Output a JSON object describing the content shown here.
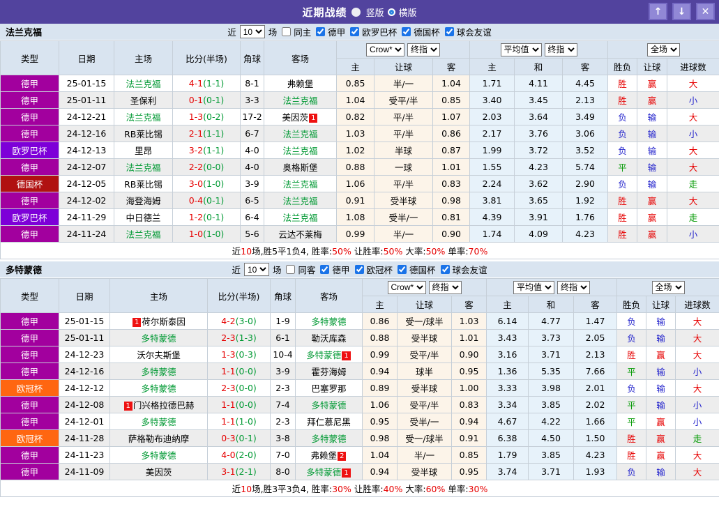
{
  "titlebar": {
    "title": "近期战绩",
    "radios": [
      {
        "label": "竖版",
        "selected": false
      },
      {
        "label": "横版",
        "selected": true
      }
    ],
    "buttons": {
      "up": "↑",
      "down": "↓",
      "close": "✕"
    }
  },
  "league_colors": {
    "德甲": "#a2009e",
    "欧罗巴杯": "#7d00d8",
    "德国杯": "#b01111",
    "欧冠杯": "#ff6611"
  },
  "result_colors": {
    "r": "#e60000",
    "b": "#2323cc",
    "g": "#009900"
  },
  "filter_labels": {
    "near": "近",
    "unit": "场"
  },
  "columns": {
    "type": "类型",
    "date": "日期",
    "home": "主场",
    "score": "比分(半场)",
    "corner": "角球",
    "away": "客场",
    "h": "主",
    "handicap": "让球",
    "a": "客",
    "avg_h": "主",
    "avg_d": "和",
    "avg_a": "客",
    "wl": "胜负",
    "hcp_res": "让球",
    "goals": "进球数"
  },
  "header_selects": {
    "odds_company": "Crow*",
    "odds_stage": "终指",
    "avg": "平均值",
    "avg_stage": "终指",
    "scope": "全场"
  },
  "sections": [
    {
      "team": "法兰克福",
      "filter": {
        "count": "10",
        "same": "同主",
        "same_checked": false,
        "leagues": [
          "德甲",
          "欧罗巴杯",
          "德国杯",
          "球会友谊"
        ]
      },
      "rows": [
        {
          "league": "德甲",
          "date": "25-01-15",
          "home": {
            "name": "法兰克福",
            "focus": true
          },
          "score": "4-1",
          "half": "(1-1)",
          "corner": "8-1",
          "away": {
            "name": "弗赖堡",
            "focus": false
          },
          "crow": [
            "0.85",
            "半/一",
            "1.04"
          ],
          "avg": [
            "1.71",
            "4.11",
            "4.45"
          ],
          "results": [
            [
              "胜",
              "r"
            ],
            [
              "赢",
              "r"
            ],
            [
              "大",
              "r"
            ]
          ]
        },
        {
          "league": "德甲",
          "date": "25-01-11",
          "home": {
            "name": "圣保利",
            "focus": false
          },
          "score": "0-1",
          "half": "(0-1)",
          "corner": "3-3",
          "away": {
            "name": "法兰克福",
            "focus": true
          },
          "crow": [
            "1.04",
            "受平/半",
            "0.85"
          ],
          "avg": [
            "3.40",
            "3.45",
            "2.13"
          ],
          "results": [
            [
              "胜",
              "r"
            ],
            [
              "赢",
              "r"
            ],
            [
              "小",
              "b"
            ]
          ]
        },
        {
          "league": "德甲",
          "date": "24-12-21",
          "home": {
            "name": "法兰克福",
            "focus": true
          },
          "score": "1-3",
          "half": "(0-2)",
          "corner": "17-2",
          "away": {
            "name": "美因茨",
            "focus": false,
            "badge": "1",
            "badge_pos": "after"
          },
          "crow": [
            "0.82",
            "平/半",
            "1.07"
          ],
          "avg": [
            "2.03",
            "3.64",
            "3.49"
          ],
          "results": [
            [
              "负",
              "b"
            ],
            [
              "输",
              "b"
            ],
            [
              "大",
              "r"
            ]
          ]
        },
        {
          "league": "德甲",
          "date": "24-12-16",
          "home": {
            "name": "RB莱比锡",
            "focus": false
          },
          "score": "2-1",
          "half": "(1-1)",
          "corner": "6-7",
          "away": {
            "name": "法兰克福",
            "focus": true
          },
          "crow": [
            "1.03",
            "平/半",
            "0.86"
          ],
          "avg": [
            "2.17",
            "3.76",
            "3.06"
          ],
          "results": [
            [
              "负",
              "b"
            ],
            [
              "输",
              "b"
            ],
            [
              "小",
              "b"
            ]
          ]
        },
        {
          "league": "欧罗巴杯",
          "date": "24-12-13",
          "home": {
            "name": "里昂",
            "focus": false
          },
          "score": "3-2",
          "half": "(1-1)",
          "corner": "4-0",
          "away": {
            "name": "法兰克福",
            "focus": true
          },
          "crow": [
            "1.02",
            "半球",
            "0.87"
          ],
          "avg": [
            "1.99",
            "3.72",
            "3.52"
          ],
          "results": [
            [
              "负",
              "b"
            ],
            [
              "输",
              "b"
            ],
            [
              "大",
              "r"
            ]
          ]
        },
        {
          "league": "德甲",
          "date": "24-12-07",
          "home": {
            "name": "法兰克福",
            "focus": true
          },
          "score": "2-2",
          "half": "(0-0)",
          "corner": "4-0",
          "away": {
            "name": "奥格斯堡",
            "focus": false
          },
          "crow": [
            "0.88",
            "一球",
            "1.01"
          ],
          "avg": [
            "1.55",
            "4.23",
            "5.74"
          ],
          "results": [
            [
              "平",
              "g"
            ],
            [
              "输",
              "b"
            ],
            [
              "大",
              "r"
            ]
          ]
        },
        {
          "league": "德国杯",
          "date": "24-12-05",
          "home": {
            "name": "RB莱比锡",
            "focus": false
          },
          "score": "3-0",
          "half": "(1-0)",
          "corner": "3-9",
          "away": {
            "name": "法兰克福",
            "focus": true
          },
          "crow": [
            "1.06",
            "平/半",
            "0.83"
          ],
          "avg": [
            "2.24",
            "3.62",
            "2.90"
          ],
          "results": [
            [
              "负",
              "b"
            ],
            [
              "输",
              "b"
            ],
            [
              "走",
              "g"
            ]
          ]
        },
        {
          "league": "德甲",
          "date": "24-12-02",
          "home": {
            "name": "海登海姆",
            "focus": false
          },
          "score": "0-4",
          "half": "(0-1)",
          "corner": "6-5",
          "away": {
            "name": "法兰克福",
            "focus": true
          },
          "crow": [
            "0.91",
            "受半球",
            "0.98"
          ],
          "avg": [
            "3.81",
            "3.65",
            "1.92"
          ],
          "results": [
            [
              "胜",
              "r"
            ],
            [
              "赢",
              "r"
            ],
            [
              "大",
              "r"
            ]
          ]
        },
        {
          "league": "欧罗巴杯",
          "date": "24-11-29",
          "home": {
            "name": "中日德兰",
            "focus": false
          },
          "score": "1-2",
          "half": "(0-1)",
          "corner": "6-4",
          "away": {
            "name": "法兰克福",
            "focus": true
          },
          "crow": [
            "1.08",
            "受半/一",
            "0.81"
          ],
          "avg": [
            "4.39",
            "3.91",
            "1.76"
          ],
          "results": [
            [
              "胜",
              "r"
            ],
            [
              "赢",
              "r"
            ],
            [
              "走",
              "g"
            ]
          ]
        },
        {
          "league": "德甲",
          "date": "24-11-24",
          "home": {
            "name": "法兰克福",
            "focus": true
          },
          "score": "1-0",
          "half": "(1-0)",
          "corner": "5-6",
          "away": {
            "name": "云达不莱梅",
            "focus": false
          },
          "crow": [
            "0.99",
            "半/一",
            "0.90"
          ],
          "avg": [
            "1.74",
            "4.09",
            "4.23"
          ],
          "results": [
            [
              "胜",
              "r"
            ],
            [
              "赢",
              "r"
            ],
            [
              "小",
              "b"
            ]
          ]
        }
      ],
      "summary": [
        [
          "近",
          "k"
        ],
        [
          "10",
          "r"
        ],
        [
          "场,胜5平1负4, 胜率:",
          "k"
        ],
        [
          "50%",
          "r"
        ],
        [
          " 让胜率:",
          "k"
        ],
        [
          "50%",
          "r"
        ],
        [
          " 大率:",
          "k"
        ],
        [
          "50%",
          "r"
        ],
        [
          " 单率:",
          "k"
        ],
        [
          "70%",
          "r"
        ]
      ]
    },
    {
      "team": "多特蒙德",
      "filter": {
        "count": "10",
        "same": "同客",
        "same_checked": false,
        "leagues": [
          "德甲",
          "欧冠杯",
          "德国杯",
          "球会友谊"
        ]
      },
      "rows": [
        {
          "league": "德甲",
          "date": "25-01-15",
          "home": {
            "name": "荷尔斯泰因",
            "focus": false,
            "badge": "1",
            "badge_pos": "before"
          },
          "score": "4-2",
          "half": "(3-0)",
          "corner": "1-9",
          "away": {
            "name": "多特蒙德",
            "focus": true
          },
          "crow": [
            "0.86",
            "受一/球半",
            "1.03"
          ],
          "avg": [
            "6.14",
            "4.77",
            "1.47"
          ],
          "results": [
            [
              "负",
              "b"
            ],
            [
              "输",
              "b"
            ],
            [
              "大",
              "r"
            ]
          ]
        },
        {
          "league": "德甲",
          "date": "25-01-11",
          "home": {
            "name": "多特蒙德",
            "focus": true
          },
          "score": "2-3",
          "half": "(1-3)",
          "corner": "6-1",
          "away": {
            "name": "勒沃库森",
            "focus": false
          },
          "crow": [
            "0.88",
            "受半球",
            "1.01"
          ],
          "avg": [
            "3.43",
            "3.73",
            "2.05"
          ],
          "results": [
            [
              "负",
              "b"
            ],
            [
              "输",
              "b"
            ],
            [
              "大",
              "r"
            ]
          ]
        },
        {
          "league": "德甲",
          "date": "24-12-23",
          "home": {
            "name": "沃尔夫斯堡",
            "focus": false
          },
          "score": "1-3",
          "half": "(0-3)",
          "corner": "10-4",
          "away": {
            "name": "多特蒙德",
            "focus": true,
            "badge": "1",
            "badge_pos": "after"
          },
          "crow": [
            "0.99",
            "受平/半",
            "0.90"
          ],
          "avg": [
            "3.16",
            "3.71",
            "2.13"
          ],
          "results": [
            [
              "胜",
              "r"
            ],
            [
              "赢",
              "r"
            ],
            [
              "大",
              "r"
            ]
          ]
        },
        {
          "league": "德甲",
          "date": "24-12-16",
          "home": {
            "name": "多特蒙德",
            "focus": true
          },
          "score": "1-1",
          "half": "(0-0)",
          "corner": "3-9",
          "away": {
            "name": "霍芬海姆",
            "focus": false
          },
          "crow": [
            "0.94",
            "球半",
            "0.95"
          ],
          "avg": [
            "1.36",
            "5.35",
            "7.66"
          ],
          "results": [
            [
              "平",
              "g"
            ],
            [
              "输",
              "b"
            ],
            [
              "小",
              "b"
            ]
          ]
        },
        {
          "league": "欧冠杯",
          "date": "24-12-12",
          "home": {
            "name": "多特蒙德",
            "focus": true
          },
          "score": "2-3",
          "half": "(0-0)",
          "corner": "2-3",
          "away": {
            "name": "巴塞罗那",
            "focus": false
          },
          "crow": [
            "0.89",
            "受半球",
            "1.00"
          ],
          "avg": [
            "3.33",
            "3.98",
            "2.01"
          ],
          "results": [
            [
              "负",
              "b"
            ],
            [
              "输",
              "b"
            ],
            [
              "大",
              "r"
            ]
          ]
        },
        {
          "league": "德甲",
          "date": "24-12-08",
          "home": {
            "name": "门兴格拉德巴赫",
            "focus": false,
            "badge": "1",
            "badge_pos": "before"
          },
          "score": "1-1",
          "half": "(0-0)",
          "corner": "7-4",
          "away": {
            "name": "多特蒙德",
            "focus": true
          },
          "crow": [
            "1.06",
            "受平/半",
            "0.83"
          ],
          "avg": [
            "3.34",
            "3.85",
            "2.02"
          ],
          "results": [
            [
              "平",
              "g"
            ],
            [
              "输",
              "b"
            ],
            [
              "小",
              "b"
            ]
          ]
        },
        {
          "league": "德甲",
          "date": "24-12-01",
          "home": {
            "name": "多特蒙德",
            "focus": true
          },
          "score": "1-1",
          "half": "(1-0)",
          "corner": "2-3",
          "away": {
            "name": "拜仁慕尼黑",
            "focus": false
          },
          "crow": [
            "0.95",
            "受半/一",
            "0.94"
          ],
          "avg": [
            "4.67",
            "4.22",
            "1.66"
          ],
          "results": [
            [
              "平",
              "g"
            ],
            [
              "赢",
              "r"
            ],
            [
              "小",
              "b"
            ]
          ]
        },
        {
          "league": "欧冠杯",
          "date": "24-11-28",
          "home": {
            "name": "萨格勒布迪纳摩",
            "focus": false
          },
          "score": "0-3",
          "half": "(0-1)",
          "corner": "3-8",
          "away": {
            "name": "多特蒙德",
            "focus": true
          },
          "crow": [
            "0.98",
            "受一/球半",
            "0.91"
          ],
          "avg": [
            "6.38",
            "4.50",
            "1.50"
          ],
          "results": [
            [
              "胜",
              "r"
            ],
            [
              "赢",
              "r"
            ],
            [
              "走",
              "g"
            ]
          ]
        },
        {
          "league": "德甲",
          "date": "24-11-23",
          "home": {
            "name": "多特蒙德",
            "focus": true
          },
          "score": "4-0",
          "half": "(2-0)",
          "corner": "7-0",
          "away": {
            "name": "弗赖堡",
            "focus": false,
            "badge": "2",
            "badge_pos": "after"
          },
          "crow": [
            "1.04",
            "半/一",
            "0.85"
          ],
          "avg": [
            "1.79",
            "3.85",
            "4.23"
          ],
          "results": [
            [
              "胜",
              "r"
            ],
            [
              "赢",
              "r"
            ],
            [
              "大",
              "r"
            ]
          ]
        },
        {
          "league": "德甲",
          "date": "24-11-09",
          "home": {
            "name": "美因茨",
            "focus": false
          },
          "score": "3-1",
          "half": "(2-1)",
          "corner": "8-0",
          "away": {
            "name": "多特蒙德",
            "focus": true,
            "badge": "1",
            "badge_pos": "after"
          },
          "crow": [
            "0.94",
            "受半球",
            "0.95"
          ],
          "avg": [
            "3.74",
            "3.71",
            "1.93"
          ],
          "results": [
            [
              "负",
              "b"
            ],
            [
              "输",
              "b"
            ],
            [
              "大",
              "r"
            ]
          ]
        }
      ],
      "summary": [
        [
          "近",
          "k"
        ],
        [
          "10",
          "r"
        ],
        [
          "场,胜3平3负4, 胜率:",
          "k"
        ],
        [
          "30%",
          "r"
        ],
        [
          " 让胜率:",
          "k"
        ],
        [
          "40%",
          "r"
        ],
        [
          " 大率:",
          "k"
        ],
        [
          "60%",
          "r"
        ],
        [
          " 单率:",
          "k"
        ],
        [
          "30%",
          "r"
        ]
      ]
    }
  ]
}
